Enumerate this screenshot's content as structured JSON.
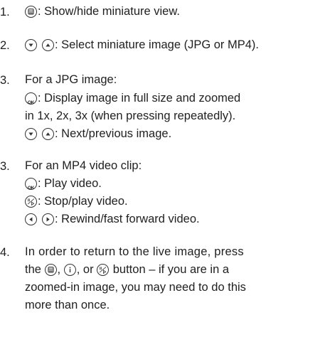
{
  "items": [
    {
      "num": "1.",
      "lines": [
        {
          "icons": [
            "gallery-icon"
          ],
          "text": ": Show/hide miniature view."
        }
      ]
    },
    {
      "num": "2.",
      "lines": [
        {
          "icons": [
            "down-arrow-icon",
            "up-arrow-icon"
          ],
          "text": ": Select miniature image (JPG or MP4)."
        }
      ]
    },
    {
      "num": "3.",
      "lines": [
        {
          "icons": [],
          "text": "For a JPG image:"
        },
        {
          "icons": [
            "ok-icon"
          ],
          "text": ": Display image in full size and zoomed"
        },
        {
          "icons": [],
          "text": "in 1x, 2x, 3x (when pressing repeatedly)."
        },
        {
          "icons": [
            "down-arrow-icon",
            "up-arrow-icon"
          ],
          "text": ": Next/previous image."
        }
      ]
    },
    {
      "num": "3.",
      "lines": [
        {
          "icons": [],
          "text": "For an MP4 video clip:"
        },
        {
          "icons": [
            "ok-icon"
          ],
          "text": ": Play video."
        },
        {
          "icons": [
            "stop-play-icon"
          ],
          "text": ": Stop/play video."
        },
        {
          "icons": [
            "left-arrow-icon",
            "right-arrow-icon"
          ],
          "text": ": Rewind/fast forward video."
        }
      ]
    },
    {
      "num": "4.",
      "lines": [
        {
          "text": "In order to return to the live image, press"
        },
        {
          "text": "the",
          "icons_after": [
            "gallery-icon"
          ],
          "text2": ",",
          "icons_after2": [
            "info-icon"
          ],
          "text3": ", or",
          "icons_after3": [
            "stop-play-icon"
          ],
          "text4": "button – if you are in a"
        },
        {
          "text": "zoomed-in image, you may need to do this"
        },
        {
          "text": "more than once."
        }
      ]
    }
  ]
}
